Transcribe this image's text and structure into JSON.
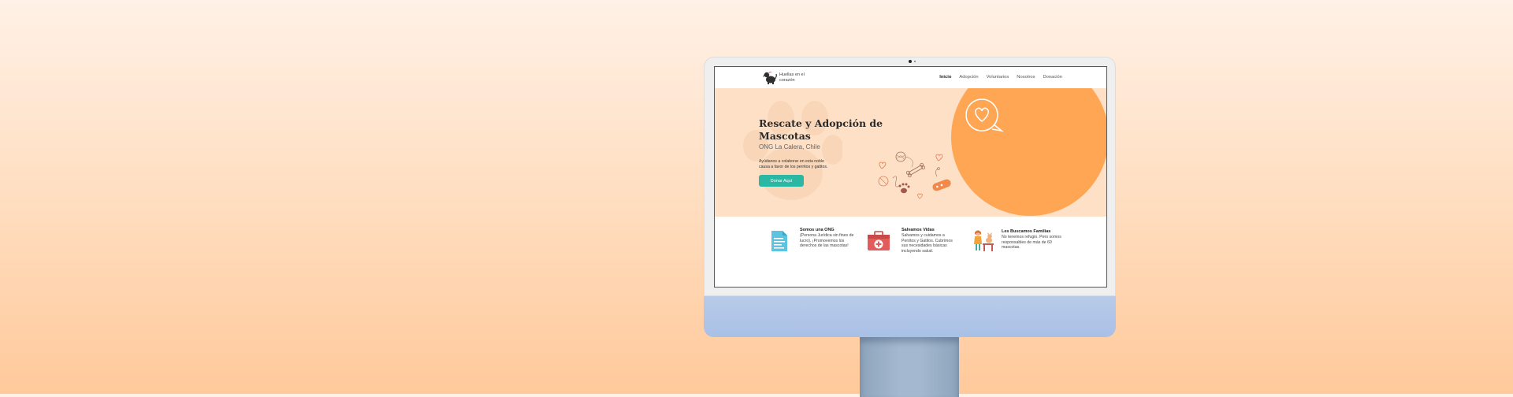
{
  "navbar": {
    "logo_text": "Huellas en el corazón",
    "items": [
      {
        "label": "Inicio",
        "active": true
      },
      {
        "label": "Adopción",
        "active": false
      },
      {
        "label": "Voluntarios",
        "active": false
      },
      {
        "label": "Nosotros",
        "active": false
      },
      {
        "label": "Donación",
        "active": false
      }
    ]
  },
  "hero": {
    "title": "Rescate y Adopción de Mascotas",
    "subtitle": "ONG La Calera, Chile",
    "description": "Ayúdanos a colaborar en esta noble causa a favor de los perritos y gatitos.",
    "button_label": "Donar Aquí"
  },
  "features": [
    {
      "title": "Somos una ONG",
      "text": "(Persona Jurídica sin fines de lucro). ¡Promovemos los derechos de las mascotas!",
      "icon": "document-icon"
    },
    {
      "title": "Salvamos Vidas",
      "text": "Salvamos y cuidamos a Perritos y Gatitos. Cubrimos sus necesidades básicas incluyendo salud.",
      "icon": "first-aid-kit-icon"
    },
    {
      "title": "Les Buscamos Familias",
      "text": "No tenemos refugio. Pero somos responsables de más de 60 mascotas.",
      "icon": "girl-with-dog-icon"
    }
  ],
  "colors": {
    "hero_bg": "#fde0c6",
    "accent_orange": "#ffa654",
    "button_teal": "#2ab8a4",
    "monitor_chin": "#b8cbe9"
  }
}
